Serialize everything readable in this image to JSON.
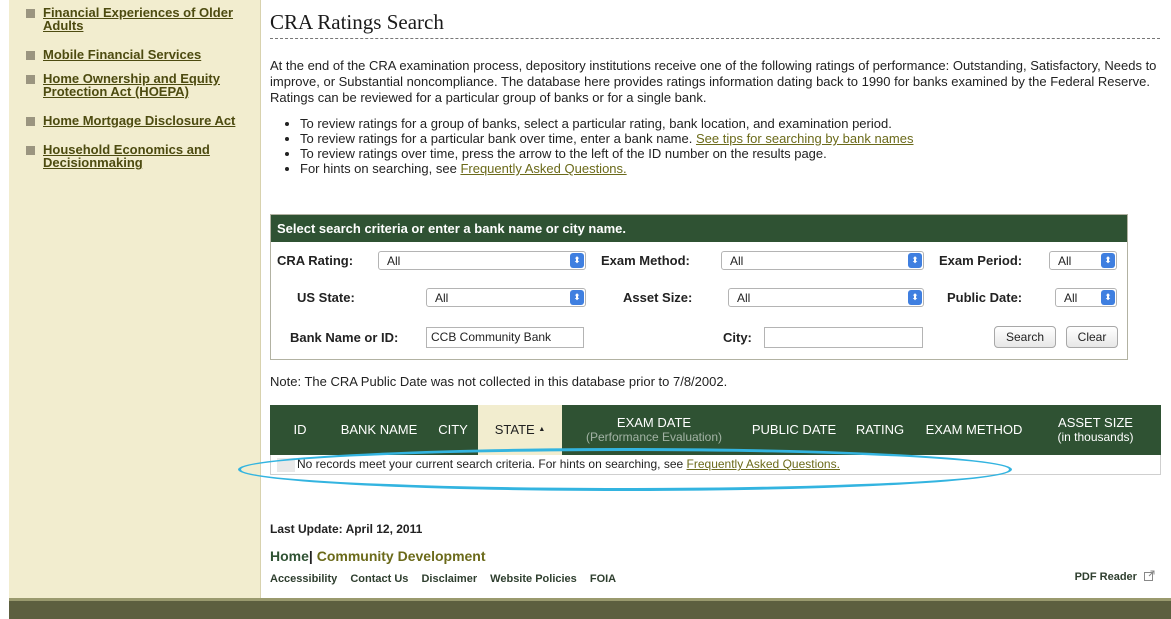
{
  "sidebar": {
    "items": [
      {
        "label": "Financial Experiences of Older Adults"
      },
      {
        "label": "Mobile Financial Services"
      },
      {
        "label": "Home Ownership and Equity Protection Act (HOEPA)"
      },
      {
        "label": "Home Mortgage Disclosure Act"
      },
      {
        "label": "Household Economics and Decisionmaking"
      }
    ]
  },
  "page": {
    "title": "CRA Ratings Search",
    "intro": "At the end of the CRA examination process, depository institutions receive one of the following ratings of performance: Outstanding, Satisfactory, Needs to improve, or Substantial noncompliance. The database here provides ratings information dating back to 1990 for banks examined by the Federal Reserve. Ratings can be reviewed for a particular group of banks or for a single bank.",
    "bullets": {
      "b1": "To review ratings for a group of banks, select a particular rating, bank location, and examination period.",
      "b2_text": "To review ratings for a particular bank over time, enter a bank name.",
      "b2_link": "See tips for searching by bank names",
      "b3": "To review ratings over time, press the arrow to the left of the ID number on the results page.",
      "b4_text": "For hints on searching, see",
      "b4_link": "Frequently Asked Questions."
    }
  },
  "search": {
    "header": "Select search criteria or enter a bank name or city name.",
    "cra_rating_label": "CRA Rating:",
    "cra_rating_value": "All",
    "exam_method_label": "Exam Method:",
    "exam_method_value": "All",
    "exam_period_label": "Exam Period:",
    "exam_period_value": "All",
    "us_state_label": "US State:",
    "us_state_value": "All",
    "asset_size_label": "Asset Size:",
    "asset_size_value": "All",
    "public_date_label": "Public Date:",
    "public_date_value": "All",
    "bank_name_label": "Bank Name or ID:",
    "bank_name_value": "CCB Community Bank",
    "city_label": "City:",
    "city_value": "",
    "search_button": "Search",
    "clear_button": "Clear"
  },
  "note": "Note: The CRA Public Date was not collected in this database prior to 7/8/2002.",
  "results": {
    "columns": {
      "id": "ID",
      "bank_name": "BANK NAME",
      "city": "CITY",
      "state": "STATE",
      "exam_date": "EXAM DATE",
      "exam_date_sub": "(Performance Evaluation)",
      "public_date": "PUBLIC DATE",
      "rating": "RATING",
      "exam_method": "EXAM METHOD",
      "asset_size": "ASSET SIZE",
      "asset_size_sub": "(in thousands)"
    },
    "sort_indicator": "▲",
    "empty_text": "No records meet your current search criteria. For hints on searching, see",
    "empty_link": "Frequently Asked Questions."
  },
  "footer": {
    "last_update": "Last Update: April 12, 2011",
    "home": "Home",
    "separator": "|",
    "community_development": "Community Development",
    "links": {
      "accessibility": "Accessibility",
      "contact": "Contact Us",
      "disclaimer": "Disclaimer",
      "policies": "Website Policies",
      "foia": "FOIA"
    },
    "pdf_reader": "PDF Reader"
  },
  "colors": {
    "header_green": "#2f5233",
    "sidebar_bg": "#f2edcf",
    "highlight": "#33b4e0"
  }
}
